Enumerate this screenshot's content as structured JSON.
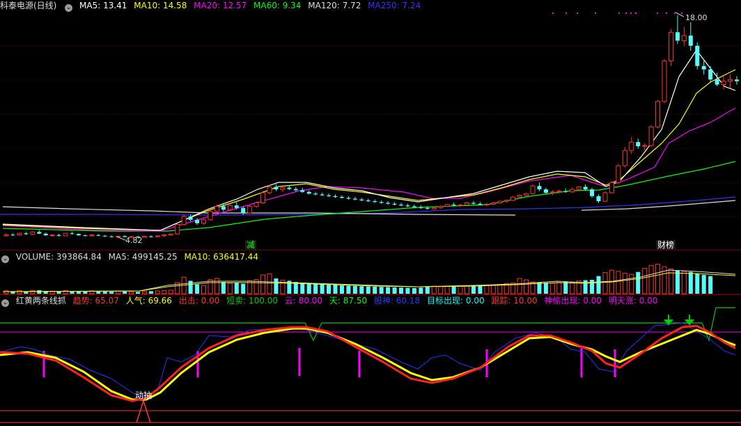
{
  "main_legend": {
    "title": "科泰电源(日线)",
    "items": [
      {
        "label": "MA5: 13.41",
        "color": "#ffffff"
      },
      {
        "label": "MA10: 14.58",
        "color": "#ffff00"
      },
      {
        "label": "MA20: 12.57",
        "color": "#ff00ff"
      },
      {
        "label": "MA60: 9.34",
        "color": "#00ff00"
      },
      {
        "label": "MA120: 7.72",
        "color": "#dddddd"
      },
      {
        "label": "MA250: 7.24",
        "color": "#3333ff"
      }
    ]
  },
  "price_annotations": {
    "high": "18.00",
    "low": "4.82"
  },
  "event_tags": {
    "left": "减",
    "right": "财榜"
  },
  "volume_legend": {
    "items": [
      {
        "label": "VOLUME: 393864.84",
        "color": "#dddddd"
      },
      {
        "label": "MA5: 499145.25",
        "color": "#dddddd"
      },
      {
        "label": "MA10: 636417.44",
        "color": "#ffff00"
      }
    ]
  },
  "indicator_legend": {
    "items": [
      {
        "label": "红黄两条线抓",
        "color": "#dddddd"
      },
      {
        "label": "趋势: 65.07",
        "color": "#ff3333"
      },
      {
        "label": "人气: 69.66",
        "color": "#ffff00"
      },
      {
        "label": "出击: 0.00",
        "color": "#ff3333"
      },
      {
        "label": "短卖: 100.00",
        "color": "#00cc00"
      },
      {
        "label": "云: 80.00",
        "color": "#ff00ff"
      },
      {
        "label": "天: 87.50",
        "color": "#00ff00"
      },
      {
        "label": "股神: 60.18",
        "color": "#3333ff"
      },
      {
        "label": "目标出现: 0.00",
        "color": "#00ffff"
      },
      {
        "label": "跟踪: 10.00",
        "color": "#ff3333"
      },
      {
        "label": "神偷出现: 0.00",
        "color": "#ff00ff"
      },
      {
        "label": "明天涨: 0.00",
        "color": "#ff00ff"
      }
    ]
  },
  "indicator_text": {
    "signal": "动抽"
  },
  "colors": {
    "up": "#ff3232",
    "down": "#54fcfc",
    "grid": "#8b0000"
  },
  "chart_data": {
    "type": "candlestick",
    "candles": [
      {
        "o": 4.95,
        "h": 5.12,
        "l": 4.9,
        "c": 5.02
      },
      {
        "o": 5.02,
        "h": 5.1,
        "l": 4.95,
        "c": 5.0
      },
      {
        "o": 5.0,
        "h": 5.15,
        "l": 4.96,
        "c": 5.1
      },
      {
        "o": 5.1,
        "h": 5.18,
        "l": 5.0,
        "c": 5.05
      },
      {
        "o": 5.05,
        "h": 5.22,
        "l": 5.0,
        "c": 5.18
      },
      {
        "o": 5.18,
        "h": 5.3,
        "l": 5.05,
        "c": 5.08
      },
      {
        "o": 5.08,
        "h": 5.14,
        "l": 4.96,
        "c": 4.98
      },
      {
        "o": 4.98,
        "h": 5.04,
        "l": 4.9,
        "c": 5.0
      },
      {
        "o": 5.0,
        "h": 5.08,
        "l": 4.92,
        "c": 4.95
      },
      {
        "o": 4.95,
        "h": 5.12,
        "l": 4.93,
        "c": 5.1
      },
      {
        "o": 5.1,
        "h": 5.2,
        "l": 5.02,
        "c": 5.06
      },
      {
        "o": 5.06,
        "h": 5.1,
        "l": 4.96,
        "c": 4.98
      },
      {
        "o": 4.98,
        "h": 5.02,
        "l": 4.92,
        "c": 4.95
      },
      {
        "o": 4.95,
        "h": 5.04,
        "l": 4.9,
        "c": 5.0
      },
      {
        "o": 5.0,
        "h": 5.06,
        "l": 4.93,
        "c": 4.96
      },
      {
        "o": 4.96,
        "h": 5.0,
        "l": 4.88,
        "c": 4.92
      },
      {
        "o": 4.92,
        "h": 4.98,
        "l": 4.86,
        "c": 4.9
      },
      {
        "o": 4.9,
        "h": 4.96,
        "l": 4.85,
        "c": 4.93
      },
      {
        "o": 4.93,
        "h": 4.98,
        "l": 4.86,
        "c": 4.88
      },
      {
        "o": 4.88,
        "h": 4.94,
        "l": 4.84,
        "c": 4.9
      },
      {
        "o": 4.9,
        "h": 4.95,
        "l": 4.82,
        "c": 4.86
      },
      {
        "o": 4.86,
        "h": 4.95,
        "l": 4.84,
        "c": 4.92
      },
      {
        "o": 4.92,
        "h": 4.98,
        "l": 4.86,
        "c": 4.9
      },
      {
        "o": 4.9,
        "h": 4.97,
        "l": 4.86,
        "c": 4.95
      },
      {
        "o": 4.95,
        "h": 5.05,
        "l": 4.9,
        "c": 5.0
      },
      {
        "o": 5.0,
        "h": 5.1,
        "l": 4.96,
        "c": 5.06
      },
      {
        "o": 5.06,
        "h": 5.7,
        "l": 5.02,
        "c": 5.62
      },
      {
        "o": 5.62,
        "h": 6.2,
        "l": 5.55,
        "c": 6.1
      },
      {
        "o": 6.1,
        "h": 6.22,
        "l": 5.8,
        "c": 5.9
      },
      {
        "o": 5.9,
        "h": 6.0,
        "l": 5.6,
        "c": 5.7
      },
      {
        "o": 5.7,
        "h": 5.95,
        "l": 5.6,
        "c": 5.9
      },
      {
        "o": 5.9,
        "h": 6.5,
        "l": 5.85,
        "c": 6.4
      },
      {
        "o": 6.4,
        "h": 6.8,
        "l": 6.3,
        "c": 6.7
      },
      {
        "o": 6.7,
        "h": 6.9,
        "l": 6.4,
        "c": 6.5
      },
      {
        "o": 6.5,
        "h": 6.8,
        "l": 6.45,
        "c": 6.75
      },
      {
        "o": 6.75,
        "h": 6.95,
        "l": 6.5,
        "c": 6.6
      },
      {
        "o": 6.6,
        "h": 6.7,
        "l": 6.2,
        "c": 6.3
      },
      {
        "o": 6.3,
        "h": 6.8,
        "l": 6.25,
        "c": 6.7
      },
      {
        "o": 6.7,
        "h": 7.0,
        "l": 6.6,
        "c": 6.9
      },
      {
        "o": 6.9,
        "h": 7.6,
        "l": 6.85,
        "c": 7.5
      },
      {
        "o": 7.5,
        "h": 7.95,
        "l": 7.4,
        "c": 7.85
      },
      {
        "o": 7.85,
        "h": 8.0,
        "l": 7.6,
        "c": 7.7
      },
      {
        "o": 7.7,
        "h": 7.9,
        "l": 7.55,
        "c": 7.8
      },
      {
        "o": 7.8,
        "h": 7.95,
        "l": 7.65,
        "c": 7.72
      },
      {
        "o": 7.72,
        "h": 7.85,
        "l": 7.55,
        "c": 7.65
      },
      {
        "o": 7.65,
        "h": 7.8,
        "l": 7.5,
        "c": 7.55
      },
      {
        "o": 7.55,
        "h": 7.65,
        "l": 7.4,
        "c": 7.45
      },
      {
        "o": 7.45,
        "h": 7.55,
        "l": 7.35,
        "c": 7.4
      },
      {
        "o": 7.4,
        "h": 7.5,
        "l": 7.3,
        "c": 7.35
      },
      {
        "o": 7.35,
        "h": 7.45,
        "l": 7.25,
        "c": 7.3
      },
      {
        "o": 7.3,
        "h": 7.4,
        "l": 7.2,
        "c": 7.25
      },
      {
        "o": 7.25,
        "h": 7.35,
        "l": 7.15,
        "c": 7.2
      },
      {
        "o": 7.2,
        "h": 7.3,
        "l": 7.1,
        "c": 7.15
      },
      {
        "o": 7.15,
        "h": 7.25,
        "l": 7.05,
        "c": 7.1
      },
      {
        "o": 7.1,
        "h": 7.2,
        "l": 7.0,
        "c": 7.05
      },
      {
        "o": 7.05,
        "h": 7.15,
        "l": 6.95,
        "c": 7.0
      },
      {
        "o": 7.0,
        "h": 7.1,
        "l": 6.9,
        "c": 6.95
      },
      {
        "o": 6.95,
        "h": 7.05,
        "l": 6.85,
        "c": 6.9
      },
      {
        "o": 6.9,
        "h": 7.0,
        "l": 6.8,
        "c": 6.85
      },
      {
        "o": 6.85,
        "h": 6.95,
        "l": 6.75,
        "c": 6.8
      },
      {
        "o": 6.8,
        "h": 6.9,
        "l": 6.7,
        "c": 6.75
      },
      {
        "o": 6.75,
        "h": 6.85,
        "l": 6.65,
        "c": 6.7
      },
      {
        "o": 6.7,
        "h": 6.8,
        "l": 6.6,
        "c": 6.65
      },
      {
        "o": 6.65,
        "h": 6.75,
        "l": 6.55,
        "c": 6.6
      },
      {
        "o": 6.6,
        "h": 6.7,
        "l": 6.5,
        "c": 6.55
      },
      {
        "o": 6.55,
        "h": 6.68,
        "l": 6.48,
        "c": 6.62
      },
      {
        "o": 6.62,
        "h": 6.75,
        "l": 6.55,
        "c": 6.7
      },
      {
        "o": 6.7,
        "h": 6.85,
        "l": 6.65,
        "c": 6.8
      },
      {
        "o": 6.8,
        "h": 6.92,
        "l": 6.7,
        "c": 6.75
      },
      {
        "o": 6.75,
        "h": 6.85,
        "l": 6.65,
        "c": 6.78
      },
      {
        "o": 6.78,
        "h": 6.95,
        "l": 6.7,
        "c": 6.9
      },
      {
        "o": 6.9,
        "h": 7.0,
        "l": 6.8,
        "c": 6.85
      },
      {
        "o": 6.85,
        "h": 6.95,
        "l": 6.75,
        "c": 6.8
      },
      {
        "o": 6.8,
        "h": 6.9,
        "l": 6.7,
        "c": 6.82
      },
      {
        "o": 6.82,
        "h": 6.95,
        "l": 6.75,
        "c": 6.9
      },
      {
        "o": 6.9,
        "h": 7.05,
        "l": 6.85,
        "c": 7.0
      },
      {
        "o": 7.0,
        "h": 7.1,
        "l": 6.9,
        "c": 7.05
      },
      {
        "o": 7.05,
        "h": 7.3,
        "l": 7.0,
        "c": 7.25
      },
      {
        "o": 7.25,
        "h": 7.4,
        "l": 7.15,
        "c": 7.35
      },
      {
        "o": 7.35,
        "h": 7.5,
        "l": 7.3,
        "c": 7.45
      },
      {
        "o": 7.45,
        "h": 8.0,
        "l": 7.4,
        "c": 7.9
      },
      {
        "o": 7.9,
        "h": 8.1,
        "l": 7.6,
        "c": 7.7
      },
      {
        "o": 7.7,
        "h": 7.8,
        "l": 7.4,
        "c": 7.5
      },
      {
        "o": 7.5,
        "h": 7.65,
        "l": 7.35,
        "c": 7.55
      },
      {
        "o": 7.55,
        "h": 7.7,
        "l": 7.45,
        "c": 7.6
      },
      {
        "o": 7.6,
        "h": 7.75,
        "l": 7.5,
        "c": 7.55
      },
      {
        "o": 7.55,
        "h": 7.8,
        "l": 7.5,
        "c": 7.7
      },
      {
        "o": 7.7,
        "h": 7.9,
        "l": 7.6,
        "c": 7.85
      },
      {
        "o": 7.85,
        "h": 8.0,
        "l": 7.6,
        "c": 7.7
      },
      {
        "o": 7.7,
        "h": 7.8,
        "l": 7.2,
        "c": 7.3
      },
      {
        "o": 7.3,
        "h": 7.4,
        "l": 6.9,
        "c": 7.0
      },
      {
        "o": 7.0,
        "h": 7.6,
        "l": 6.95,
        "c": 7.5
      },
      {
        "o": 7.5,
        "h": 8.2,
        "l": 7.45,
        "c": 8.1
      },
      {
        "o": 8.1,
        "h": 9.2,
        "l": 8.0,
        "c": 9.1
      },
      {
        "o": 9.1,
        "h": 10.2,
        "l": 9.0,
        "c": 10.0
      },
      {
        "o": 10.0,
        "h": 10.8,
        "l": 9.8,
        "c": 10.5
      },
      {
        "o": 10.5,
        "h": 10.7,
        "l": 10.1,
        "c": 10.25
      },
      {
        "o": 10.25,
        "h": 10.45,
        "l": 10.0,
        "c": 10.3
      },
      {
        "o": 10.3,
        "h": 11.5,
        "l": 10.2,
        "c": 11.4
      },
      {
        "o": 11.4,
        "h": 13.0,
        "l": 11.3,
        "c": 12.9
      },
      {
        "o": 12.9,
        "h": 15.4,
        "l": 12.8,
        "c": 15.3
      },
      {
        "o": 15.3,
        "h": 17.2,
        "l": 15.0,
        "c": 17.0
      },
      {
        "o": 17.0,
        "h": 18.0,
        "l": 16.3,
        "c": 16.5
      },
      {
        "o": 16.5,
        "h": 17.3,
        "l": 16.2,
        "c": 16.8
      },
      {
        "o": 16.8,
        "h": 17.6,
        "l": 15.9,
        "c": 16.2
      },
      {
        "o": 16.2,
        "h": 16.4,
        "l": 14.8,
        "c": 15.0
      },
      {
        "o": 15.0,
        "h": 15.4,
        "l": 14.5,
        "c": 14.8
      },
      {
        "o": 14.8,
        "h": 15.0,
        "l": 14.0,
        "c": 14.2
      },
      {
        "o": 14.2,
        "h": 14.6,
        "l": 13.8,
        "c": 13.9
      },
      {
        "o": 13.9,
        "h": 14.4,
        "l": 13.6,
        "c": 14.1
      },
      {
        "o": 14.1,
        "h": 14.5,
        "l": 13.7,
        "c": 14.2
      },
      {
        "o": 14.2,
        "h": 14.4,
        "l": 13.9,
        "c": 14.1
      }
    ],
    "volumes": [
      25,
      22,
      28,
      20,
      26,
      30,
      24,
      22,
      20,
      26,
      24,
      22,
      20,
      24,
      22,
      20,
      18,
      22,
      20,
      18,
      16,
      20,
      22,
      24,
      26,
      30,
      95,
      140,
      110,
      80,
      70,
      120,
      130,
      100,
      90,
      95,
      85,
      110,
      120,
      160,
      170,
      130,
      115,
      110,
      100,
      95,
      90,
      85,
      80,
      78,
      74,
      70,
      68,
      66,
      64,
      62,
      60,
      58,
      56,
      54,
      52,
      50,
      48,
      52,
      58,
      64,
      60,
      62,
      68,
      66,
      64,
      66,
      70,
      74,
      72,
      80,
      88,
      92,
      130,
      118,
      100,
      96,
      94,
      90,
      96,
      102,
      98,
      110,
      115,
      118,
      150,
      180,
      200,
      190,
      175,
      165,
      185,
      215,
      240,
      250,
      230,
      210,
      200,
      190,
      185,
      170,
      160,
      150
    ]
  }
}
